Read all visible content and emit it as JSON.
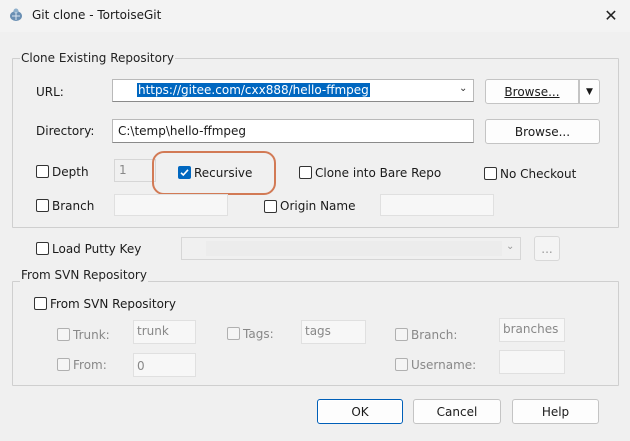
{
  "window": {
    "title": "Git clone - TortoiseGit"
  },
  "clone_group": {
    "label": "Clone Existing Repository",
    "url": {
      "label": "URL:",
      "value": "https://gitee.com/cxx888/hello-ffmpeg"
    },
    "browse_url_label": "Browse...",
    "directory": {
      "label": "Directory:",
      "value": "C:\\temp\\hello-ffmpeg"
    },
    "browse_dir_label": "Browse...",
    "depth": {
      "label": "Depth",
      "value": "1"
    },
    "recursive": {
      "label": "Recursive"
    },
    "clone_bare": {
      "label": "Clone into Bare Repo"
    },
    "no_checkout": {
      "label": "No Checkout"
    },
    "branch": {
      "label": "Branch"
    },
    "origin_name": {
      "label": "Origin Name"
    }
  },
  "putty": {
    "label": "Load Putty Key",
    "browse_label": "..."
  },
  "svn_group": {
    "label": "From SVN Repository",
    "checkbox_label": "From SVN Repository",
    "trunk": {
      "label": "Trunk:",
      "value": "trunk"
    },
    "tags": {
      "label": "Tags:",
      "value": "tags"
    },
    "branch": {
      "label": "Branch:",
      "value": "branches"
    },
    "from": {
      "label": "From:",
      "value": "0"
    },
    "username": {
      "label": "Username:"
    }
  },
  "buttons": {
    "ok": "OK",
    "cancel": "Cancel",
    "help": "Help"
  },
  "colors": {
    "accent": "#0067c0",
    "annotation": "#d27a55"
  }
}
